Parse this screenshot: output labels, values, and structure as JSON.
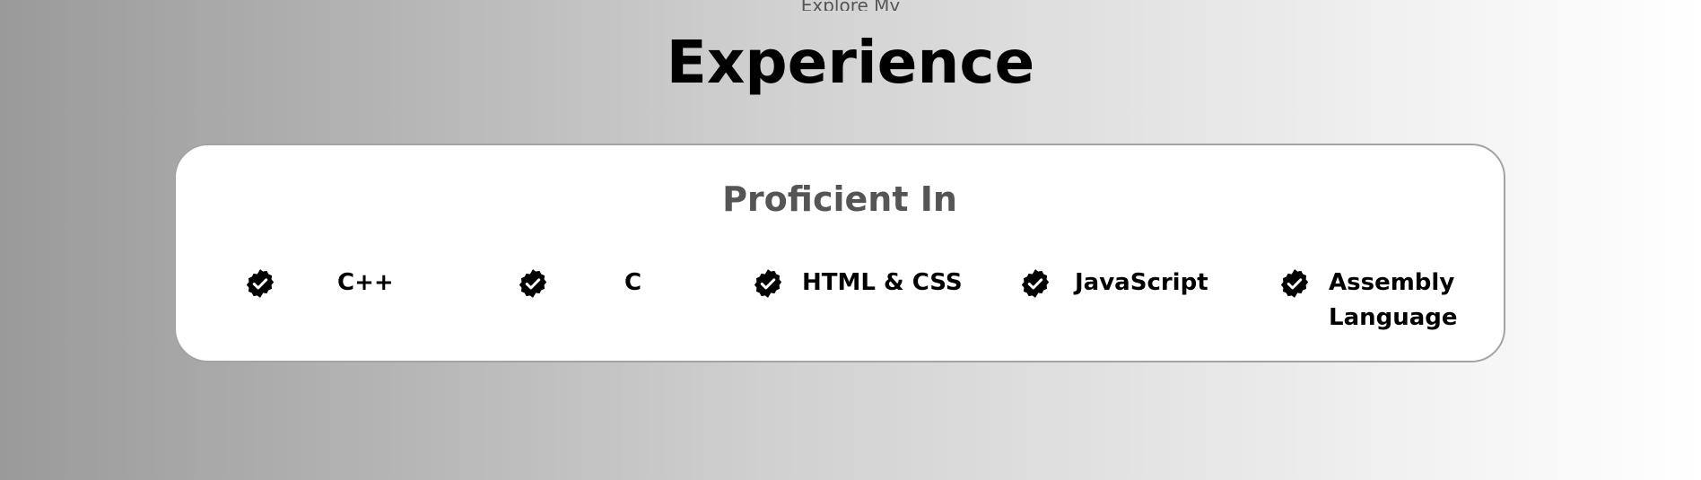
{
  "section": {
    "eyebrow": "Explore My",
    "title": "Experience"
  },
  "card": {
    "title": "Proficient In",
    "skills": [
      {
        "label": "C++",
        "icon": "check-badge-icon"
      },
      {
        "label": "C",
        "icon": "check-badge-icon"
      },
      {
        "label": "HTML & CSS",
        "icon": "check-badge-icon"
      },
      {
        "label": "JavaScript",
        "icon": "check-badge-icon"
      },
      {
        "label": "Assembly Language",
        "icon": "check-badge-icon"
      }
    ]
  },
  "colors": {
    "badge": "#000000",
    "card_background": "#ffffff",
    "card_title": "#555555"
  }
}
